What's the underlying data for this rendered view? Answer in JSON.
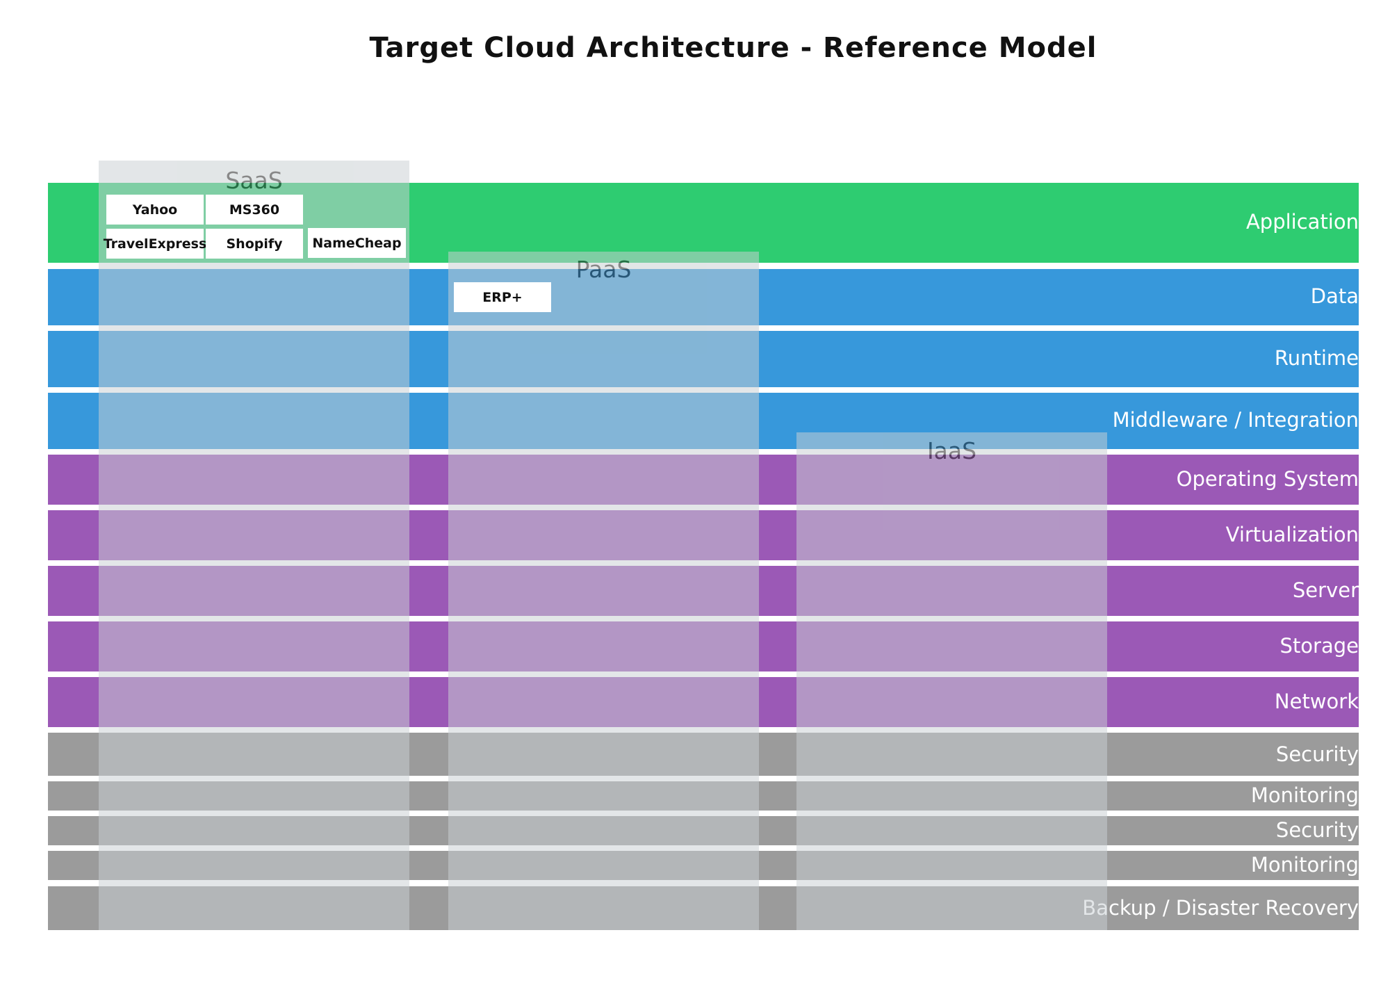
{
  "title": "Target Cloud Architecture - Reference Model",
  "colors": {
    "application": "#2ecc71",
    "data_tier": "#3798db",
    "infrastructure": "#9b59b6",
    "operations": "#9b9b9b",
    "overlay": "#c9d0d3",
    "box": "#ffffff"
  },
  "layers": [
    {
      "id": "application",
      "label": "Application",
      "group": "application"
    },
    {
      "id": "data",
      "label": "Data",
      "group": "data_tier"
    },
    {
      "id": "runtime",
      "label": "Runtime",
      "group": "data_tier"
    },
    {
      "id": "middleware",
      "label": "Middleware / Integration",
      "group": "data_tier"
    },
    {
      "id": "operating-system",
      "label": "Operating System",
      "group": "infrastructure"
    },
    {
      "id": "virtualization",
      "label": "Virtualization",
      "group": "infrastructure"
    },
    {
      "id": "server",
      "label": "Server",
      "group": "infrastructure"
    },
    {
      "id": "storage",
      "label": "Storage",
      "group": "infrastructure"
    },
    {
      "id": "network",
      "label": "Network",
      "group": "infrastructure"
    },
    {
      "id": "security-1",
      "label": "Security",
      "group": "operations"
    },
    {
      "id": "monitoring-1",
      "label": "Monitoring",
      "group": "operations"
    },
    {
      "id": "security-2",
      "label": "Security",
      "group": "operations"
    },
    {
      "id": "monitoring-2",
      "label": "Monitoring",
      "group": "operations"
    },
    {
      "id": "backup",
      "label": "Backup / Disaster Recovery",
      "group": "operations"
    }
  ],
  "service_models": [
    {
      "id": "saas",
      "label": "SaaS",
      "apps": [
        "Yahoo",
        "MS360",
        "TravelExpress",
        "Shopify",
        "NameCheap"
      ]
    },
    {
      "id": "paas",
      "label": "PaaS",
      "apps": [
        "ERP+"
      ]
    },
    {
      "id": "iaas",
      "label": "IaaS",
      "apps": []
    }
  ]
}
